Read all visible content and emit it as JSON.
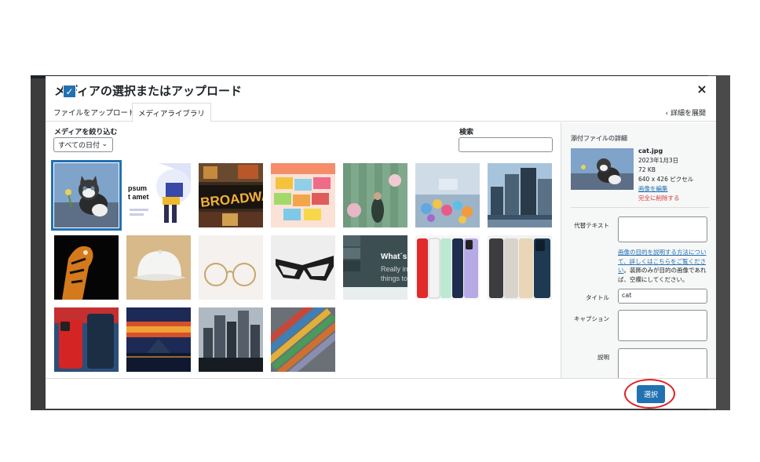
{
  "modal": {
    "title": "メディアの選択またはアップロード",
    "close": "×"
  },
  "tabs": {
    "upload": "ファイルをアップロード",
    "library": "メディアライブラリ",
    "details_toggle": "‹ 詳細を展開"
  },
  "filter": {
    "label": "メディアを絞り込む",
    "date_value": "すべての日付",
    "search_label": "検索",
    "search_placeholder": ""
  },
  "grid": {
    "items": [
      {
        "icon": "cat-image",
        "selected": true
      },
      {
        "icon": "lorem-ipsum-illustration",
        "text": "psum t amet"
      },
      {
        "icon": "broadway-sign-image",
        "text": "BROADWAY"
      },
      {
        "icon": "envelopes-image"
      },
      {
        "icon": "green-wall-image"
      },
      {
        "icon": "flowers-image"
      },
      {
        "icon": "city-buildings-image"
      },
      {
        "icon": "tiger-image"
      },
      {
        "icon": "white-cap-image"
      },
      {
        "icon": "gold-glasses-image"
      },
      {
        "icon": "black-glasses-image"
      },
      {
        "icon": "slide-preview-image",
        "text": "What's",
        "text2": "Really in",
        "text3": "things to"
      },
      {
        "icon": "iphone-colors-image"
      },
      {
        "icon": "iphone-pro-image"
      },
      {
        "icon": "red-iphone-image"
      },
      {
        "icon": "pyramid-sunset-image"
      },
      {
        "icon": "skyline-image"
      },
      {
        "icon": "containers-aerial-image"
      }
    ]
  },
  "sidebar": {
    "title": "添付ファイルの詳細",
    "filename": "cat.jpg",
    "date": "2023年1月3日",
    "size": "72 KB",
    "dimensions": "640 x 426 ピクセル",
    "edit_link": "画像を編集",
    "delete_link": "完全に削除する",
    "alt_label": "代替テキスト",
    "alt_value": "",
    "alt_help_link": "画像の目的を説明する方法について、詳しくはこちらをご覧ください",
    "alt_help_text": "。装飾のみが目的の画像であれば、空欄にしてください。",
    "title_label": "タイトル",
    "title_value": "cat",
    "caption_label": "キャプション",
    "caption_value": "",
    "description_label": "説明",
    "description_value": ""
  },
  "footer": {
    "select_button": "選択"
  },
  "colors": {
    "accent": "#2271b1",
    "danger": "#d63638",
    "highlight": "#e02020"
  }
}
